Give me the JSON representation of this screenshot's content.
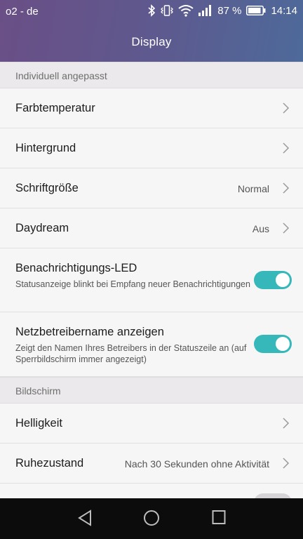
{
  "status": {
    "carrier": "o2 - de",
    "battery": "87 %",
    "time": "14:14"
  },
  "header": {
    "title": "Display"
  },
  "sections": [
    {
      "label": "Individuell angepasst"
    },
    {
      "label": "Bildschirm"
    }
  ],
  "rows": {
    "farbtemperatur": {
      "label": "Farbtemperatur"
    },
    "hintergrund": {
      "label": "Hintergrund"
    },
    "schriftgroesse": {
      "label": "Schriftgröße",
      "value": "Normal"
    },
    "daydream": {
      "label": "Daydream",
      "value": "Aus"
    },
    "led": {
      "label": "Benachrichtigungs-LED",
      "sub": "Statusanzeige blinkt bei Empfang neuer Benachrichtigungen",
      "enabled": true
    },
    "netzbetreiber": {
      "label": "Netzbetreibername anzeigen",
      "sub": "Zeigt den Namen Ihres Betreibers in der Statuszeile an (auf Sperrbildschirm immer angezeigt)",
      "enabled": true
    },
    "helligkeit": {
      "label": "Helligkeit"
    },
    "ruhezustand": {
      "label": "Ruhezustand",
      "value": "Nach 30 Sekunden ohne Aktivität"
    }
  },
  "colors": {
    "accent_toggle": "#36b8bb",
    "header_start": "#6a4f86",
    "header_end": "#4d6a9a"
  },
  "icons": [
    "bluetooth-icon",
    "vibrate-icon",
    "wifi-icon",
    "signal-icon",
    "battery-icon",
    "chevron-right-icon",
    "back-icon",
    "home-icon",
    "recents-icon"
  ]
}
